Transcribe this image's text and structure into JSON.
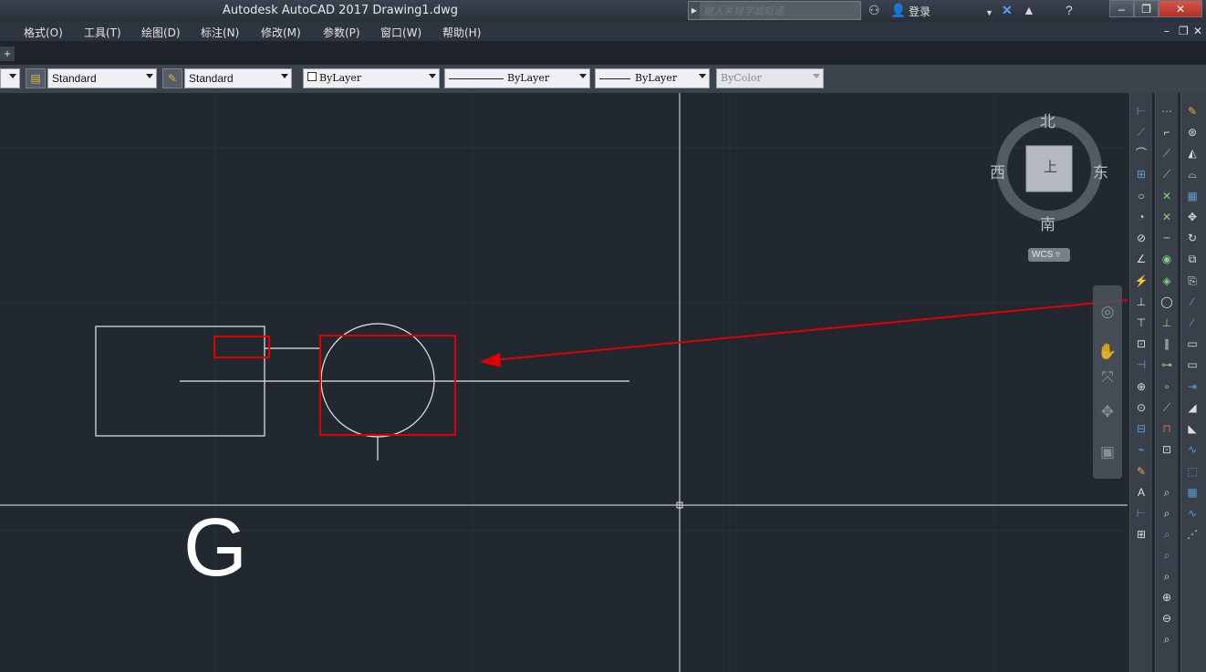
{
  "window": {
    "title": "Autodesk AutoCAD 2017    Drawing1.dwg",
    "search_placeholder": "键入关键字或短语",
    "login_label": "登录",
    "controls": [
      "minimize-icon",
      "restore-icon",
      "close-icon"
    ]
  },
  "menu": {
    "items": [
      {
        "label": "格式(O)"
      },
      {
        "label": "工具(T)"
      },
      {
        "label": "绘图(D)"
      },
      {
        "label": "标注(N)"
      },
      {
        "label": "修改(M)"
      },
      {
        "label": "参数(P)"
      },
      {
        "label": "窗口(W)"
      },
      {
        "label": "帮助(H)"
      }
    ],
    "doc_controls": [
      "minimize-icon",
      "restore-icon",
      "close-icon"
    ]
  },
  "toolbar": {
    "text_style": "Standard",
    "dim_style": "Standard",
    "layer_color": "ByLayer",
    "linetype": "ByLayer",
    "lineweight": "ByLayer",
    "plot_style": "ByColor"
  },
  "viewcube": {
    "north": "北",
    "south": "南",
    "east": "东",
    "west": "西",
    "face_label": "上",
    "wcs_label": "WCS"
  },
  "drawing": {
    "annotation_letter": "G",
    "highlight_color": "#e00000",
    "line_color": "#e8e8e8",
    "background_color": "#222830"
  }
}
